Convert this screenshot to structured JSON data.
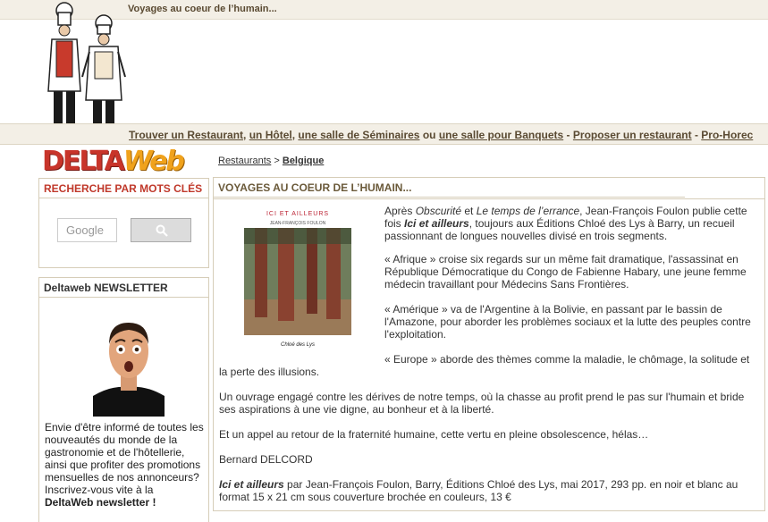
{
  "header": {
    "tagline": "Voyages au coeur de l’humain..."
  },
  "nav": {
    "restaurant": "Trouver un Restaurant",
    "comma1": ",",
    "hotel": "un Hôtel",
    "comma2": ",",
    "seminaires": "une salle de Séminaires",
    "ou": "ou",
    "banquets": "une salle pour Banquets",
    "dash1": "-",
    "proposer": "Proposer un restaurant",
    "dash2": "-",
    "pro": "Pro-Horec"
  },
  "logo": {
    "part1": "DELTA",
    "part2": "Web"
  },
  "breadcrumb": {
    "root": "Restaurants",
    "sep": ">",
    "current": "Belgique"
  },
  "search": {
    "title": "RECHERCHE PAR MOTS CLÉS",
    "placeholder": "Google"
  },
  "newsletter": {
    "title": "Deltaweb NEWSLETTER",
    "line1": "Envie d'être informé de toutes les",
    "line2": "nouveautés du monde de la",
    "line3": "gastronomie et de l'hôtellerie,",
    "line4": "ainsi que profiter des promotions",
    "line5": "mensuelles de nos annonceurs?",
    "line6": "Inscrivez-vous vite à la",
    "link": "DeltaWeb newsletter",
    "end": " !"
  },
  "article": {
    "title": "VOYAGES AU COEUR DE L’HUMAIN...",
    "cover": {
      "title": "ICI ET AILLEURS",
      "author": "JEAN-FRANÇOIS FOULON",
      "publisher": "Chloé des Lys"
    },
    "p1": {
      "a": "Après ",
      "b": "Obscurité",
      "c": " et ",
      "d": "Le temps de l’errance",
      "e": ", Jean-François Foulon publie cette",
      "f": "fois ",
      "g": "Ici et ailleurs",
      "h": ", toujours aux Éditions Chloé des Lys à Barry, un recueil",
      "i": "passionnant de longues nouvelles divisé en trois segments."
    },
    "p2": {
      "l1": "« Afrique » croise six regards sur un même fait dramatique, l'assassinat en",
      "l2": "République Démocratique du Congo de Fabienne Habary, une jeune femme",
      "l3": "médecin travaillant pour Médecins Sans Frontières."
    },
    "p3": {
      "l1": "« Amérique » va de l'Argentine à la Bolivie, en passant par le bassin de",
      "l2": "l'Amazone, pour aborder les problèmes sociaux et la lutte des peuples contre",
      "l3": "l'exploitation."
    },
    "p4": {
      "l1": "« Europe » aborde des thèmes comme la maladie, le chômage, la solitude et",
      "l2": "la perte des illusions."
    },
    "p5": {
      "l1": "Un ouvrage engagé contre les dérives de notre temps, où la chasse au profit prend le pas sur l'humain et bride",
      "l2": "ses aspirations à une vie digne, au bonheur et à la liberté."
    },
    "p6": "Et un appel au retour de la fraternité humaine, cette vertu en pleine obsolescence, hélas…",
    "signature": "Bernard DELCORD",
    "ref": {
      "title": "Ici et ailleurs",
      "l1": " par Jean-François Foulon, Barry, Éditions Chloé des Lys, mai 2017, 293 pp. en noir et blanc au",
      "l2": "format 15 x 21 cm sous couverture brochée en couleurs, 13 €"
    }
  }
}
